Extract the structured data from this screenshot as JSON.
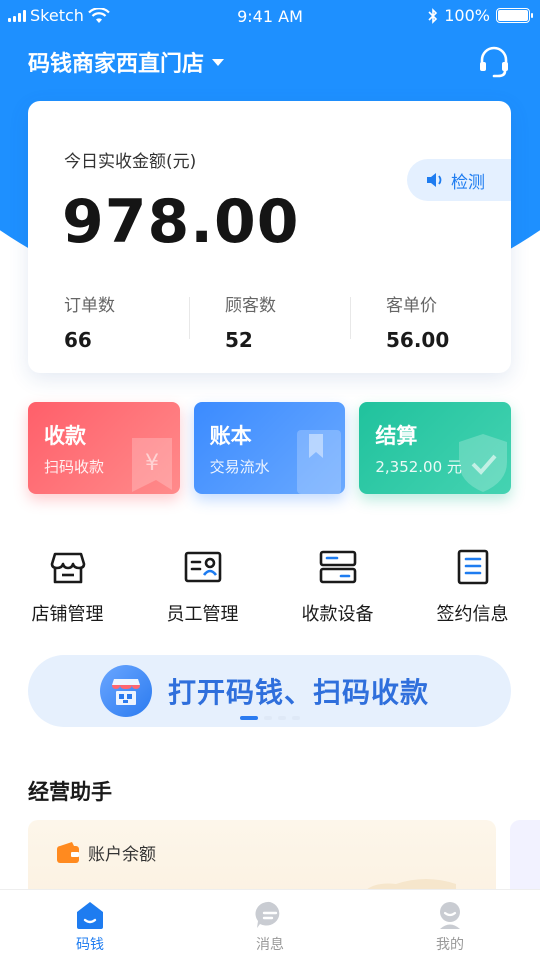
{
  "status_bar": {
    "carrier": "Sketch",
    "time": "9:41 AM",
    "battery": "100%"
  },
  "header": {
    "store_name": "码钱商家西直门店"
  },
  "summary": {
    "label": "今日实收金额(元)",
    "amount": "978.00",
    "detect_label": "检测",
    "stats": [
      {
        "label": "订单数",
        "value": "66"
      },
      {
        "label": "顾客数",
        "value": "52"
      },
      {
        "label": "客单价",
        "value": "56.00"
      }
    ]
  },
  "tiles": [
    {
      "title": "收款",
      "subtitle": "扫码收款",
      "color": "#ff6670"
    },
    {
      "title": "账本",
      "subtitle": "交易流水",
      "color": "#4a95ff"
    },
    {
      "title": "结算",
      "subtitle": "2,352.00 元",
      "color": "#2bc7a3"
    }
  ],
  "tile_icons": {
    "collect": "yen",
    "ledger": "bookmark",
    "settle": "shield-check"
  },
  "quick_actions": [
    {
      "label": "店铺管理",
      "icon": "store-icon"
    },
    {
      "label": "员工管理",
      "icon": "id-card-icon"
    },
    {
      "label": "收款设备",
      "icon": "device-icon"
    },
    {
      "label": "签约信息",
      "icon": "document-icon"
    }
  ],
  "banner": {
    "text": "打开码钱、扫码收款",
    "active_slide": 1,
    "slide_count": 4
  },
  "section": {
    "title": "经营助手"
  },
  "account": {
    "label": "账户余额"
  },
  "tabbar": [
    {
      "label": "码钱",
      "active": true
    },
    {
      "label": "消息",
      "active": false
    },
    {
      "label": "我的",
      "active": false
    }
  ],
  "colors": {
    "primary": "#1e90ff",
    "active_tab": "#1e7cf0"
  }
}
